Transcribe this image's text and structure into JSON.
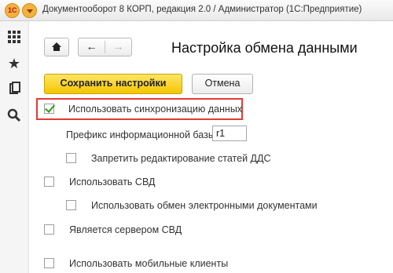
{
  "window": {
    "title": "Документооборот 8 КОРП, редакция 2.0 / Администратор  (1С:Предприятие)"
  },
  "app_logo": "1С",
  "page_title": "Настройка обмена данными",
  "buttons": {
    "save": "Сохранить настройки",
    "cancel": "Отмена"
  },
  "settings": {
    "sync": {
      "label": "Использовать синхронизацию данных",
      "checked": true
    },
    "prefix": {
      "label": "Префикс информационной базы:",
      "value": "r1"
    },
    "forbid_dds": {
      "label": "Запретить редактирование статей ДДС",
      "checked": false
    },
    "use_svd": {
      "label": "Использовать СВД",
      "checked": false
    },
    "use_edo": {
      "label": "Использовать обмен электронными документами",
      "checked": false
    },
    "svd_server": {
      "label": "Является сервером СВД",
      "checked": false
    },
    "mobile": {
      "label": "Использовать мобильные клиенты",
      "checked": false
    }
  },
  "colors": {
    "accent_yellow": "#f3c600",
    "highlight_red": "#e33a33",
    "check_green": "#2a9d1f"
  }
}
